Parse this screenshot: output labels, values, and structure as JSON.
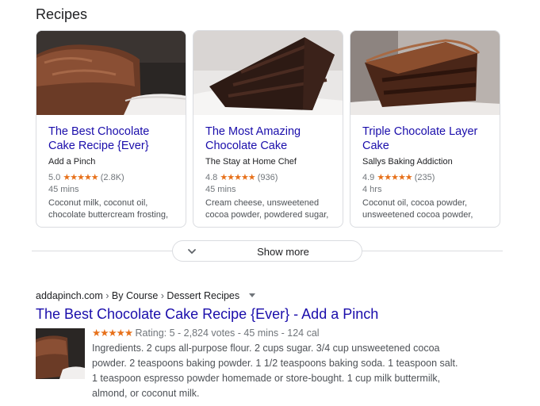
{
  "section": {
    "title": "Recipes"
  },
  "cards": [
    {
      "title": "The Best Chocolate Cake Recipe {Ever}",
      "source": "Add a Pinch",
      "rating": "5.0",
      "stars": "★★★★★",
      "votes": "(2.8K)",
      "time": "45 mins",
      "ingredients": "Coconut milk, coconut oil, chocolate buttercream frosting,"
    },
    {
      "title": "The Most Amazing Chocolate Cake",
      "source": "The Stay at Home Chef",
      "rating": "4.8",
      "stars": "★★★★★",
      "votes": "(936)",
      "time": "45 mins",
      "ingredients": "Cream cheese, unsweetened cocoa powder, powdered sugar,"
    },
    {
      "title": "Triple Chocolate Layer Cake",
      "source": "Sallys Baking Addiction",
      "rating": "4.9",
      "stars": "★★★★★",
      "votes": "(235)",
      "time": "4 hrs",
      "ingredients": "Coconut oil, cocoa powder, unsweetened cocoa powder,"
    }
  ],
  "show_more": {
    "label": "Show more",
    "icon": "chevron-down-icon"
  },
  "result": {
    "breadcrumb": {
      "domain": "addapinch.com",
      "sep1": "›",
      "part1": "By Course",
      "sep2": "›",
      "part2": "Dessert Recipes"
    },
    "title": "The Best Chocolate Cake Recipe {Ever} - Add a Pinch",
    "stars": "★★★★★",
    "meta": "Rating: 5 - 2,824 votes - 45 mins - 124 cal",
    "snippet": "Ingredients. 2 cups all-purpose flour. 2 cups sugar. 3/4 cup unsweetened cocoa powder. 2 teaspoons baking powder. 1 1/2 teaspoons baking soda. 1 teaspoon salt. 1 teaspoon espresso powder homemade or store-bought. 1 cup milk buttermilk, almond, or coconut milk."
  },
  "colors": {
    "link": "#1a0dab",
    "star": "#e7711b",
    "border": "#dadce0",
    "muted": "#70757a"
  }
}
